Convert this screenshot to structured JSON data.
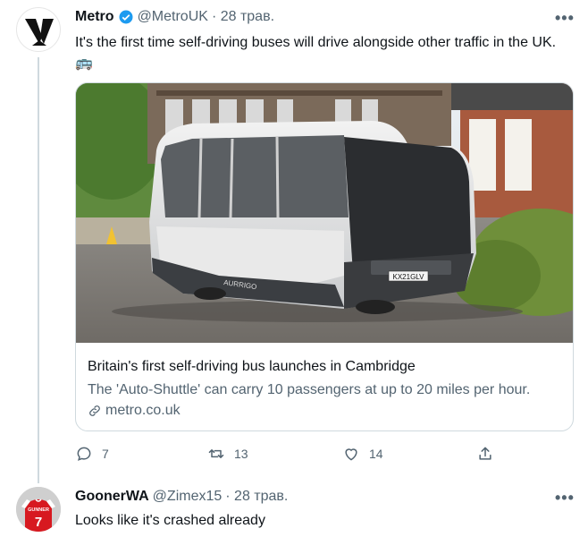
{
  "tweet": {
    "name": "Metro",
    "handle": "@MetroUK",
    "date": "· 28 трав.",
    "text": "It's the first time self-driving buses will drive alongside other traffic in the UK.",
    "emoji": "🚌",
    "card": {
      "title": "Britain's first self-driving bus launches in Cambridge",
      "description": "The 'Auto-Shuttle' can carry 10 passengers at up to 20 miles per hour.",
      "domain": "metro.co.uk",
      "bus_plate": "KX21GLV",
      "bus_brand": "AURRIGO"
    },
    "actions": {
      "replies": "7",
      "retweets": "13",
      "likes": "14"
    }
  },
  "reply": {
    "name": "GoonerWA",
    "handle": "@Zimex15",
    "date": "· 28 трав.",
    "text": "Looks like it's crashed already",
    "avatar_text": "GUNNER",
    "avatar_number": "7"
  },
  "more_label": "•••",
  "colors": {
    "verified": "#1d9bf0",
    "muted": "#536471",
    "border": "#cfd9de"
  },
  "icons": [
    "verified-badge-icon",
    "more-icon",
    "link-icon",
    "reply-icon",
    "retweet-icon",
    "like-icon",
    "share-icon"
  ]
}
